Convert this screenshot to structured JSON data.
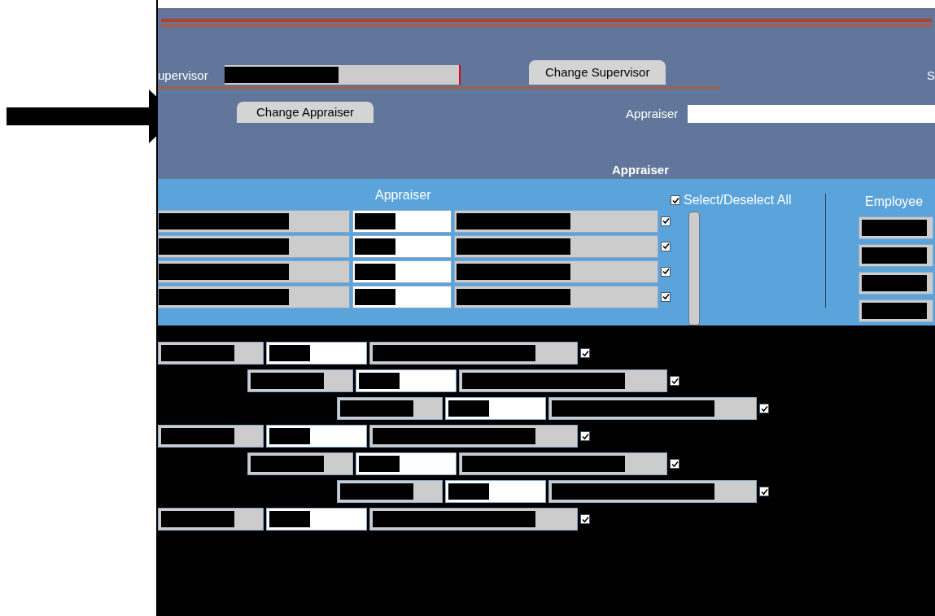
{
  "supervisor": {
    "label": "upervisor",
    "button": "Change Supervisor",
    "edge_label": "S"
  },
  "appraiser": {
    "button": "Change Appraiser",
    "label": "Appraiser"
  },
  "section": {
    "title": "Appraiser"
  },
  "table": {
    "columns": [
      "Appraiser",
      "Employee"
    ],
    "select_all": {
      "label": "Select/Deselect All",
      "checked": true
    },
    "rows": [
      {
        "checked": true
      },
      {
        "checked": true
      },
      {
        "checked": true
      },
      {
        "checked": true
      }
    ]
  },
  "lower_rows": [
    {
      "checked": true
    },
    {
      "checked": true
    },
    {
      "checked": true
    },
    {
      "checked": true
    },
    {
      "checked": true
    },
    {
      "checked": true
    },
    {
      "checked": true
    }
  ]
}
